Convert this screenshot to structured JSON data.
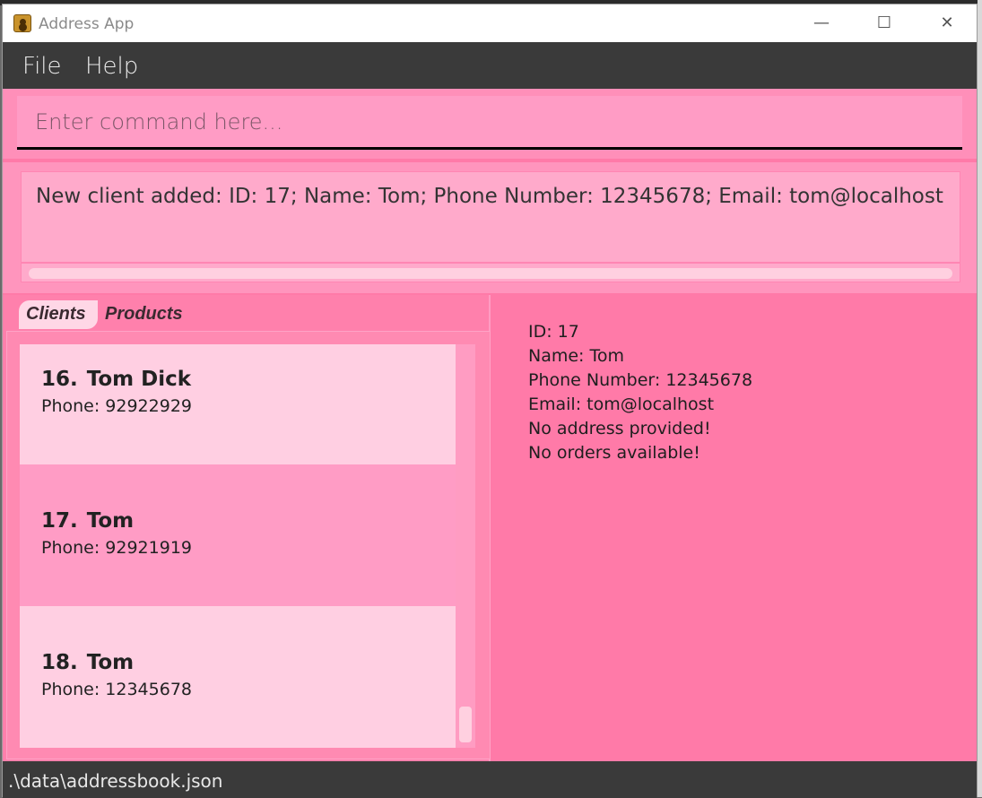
{
  "window": {
    "title": "Address App"
  },
  "menubar": {
    "items": [
      "File",
      "Help"
    ]
  },
  "command": {
    "placeholder": "Enter command here..."
  },
  "result": {
    "text": "New client added: ID: 17; Name: Tom; Phone Number: 12345678; Email: tom@localhost"
  },
  "tabs": [
    {
      "label": "Clients",
      "selected": true
    },
    {
      "label": "Products",
      "selected": false
    }
  ],
  "clients": [
    {
      "index": "16.",
      "name": "Tom Dick",
      "phone": "Phone: 92922929"
    },
    {
      "index": "17.",
      "name": "Tom",
      "phone": "Phone: 92921919"
    },
    {
      "index": "18.",
      "name": "Tom",
      "phone": "Phone: 12345678"
    }
  ],
  "detail": {
    "id": "ID: 17",
    "name": "Name: Tom",
    "phone": "Phone Number: 12345678",
    "email": "Email: tom@localhost",
    "address": "No address provided!",
    "orders": "No orders available!"
  },
  "status": {
    "path": ".\\data\\addressbook.json"
  },
  "colors": {
    "accent": "#ff7aa8",
    "card_light": "#ffcfe2",
    "card_selected": "#ff9cc5",
    "menubar": "#3a3a3a"
  }
}
